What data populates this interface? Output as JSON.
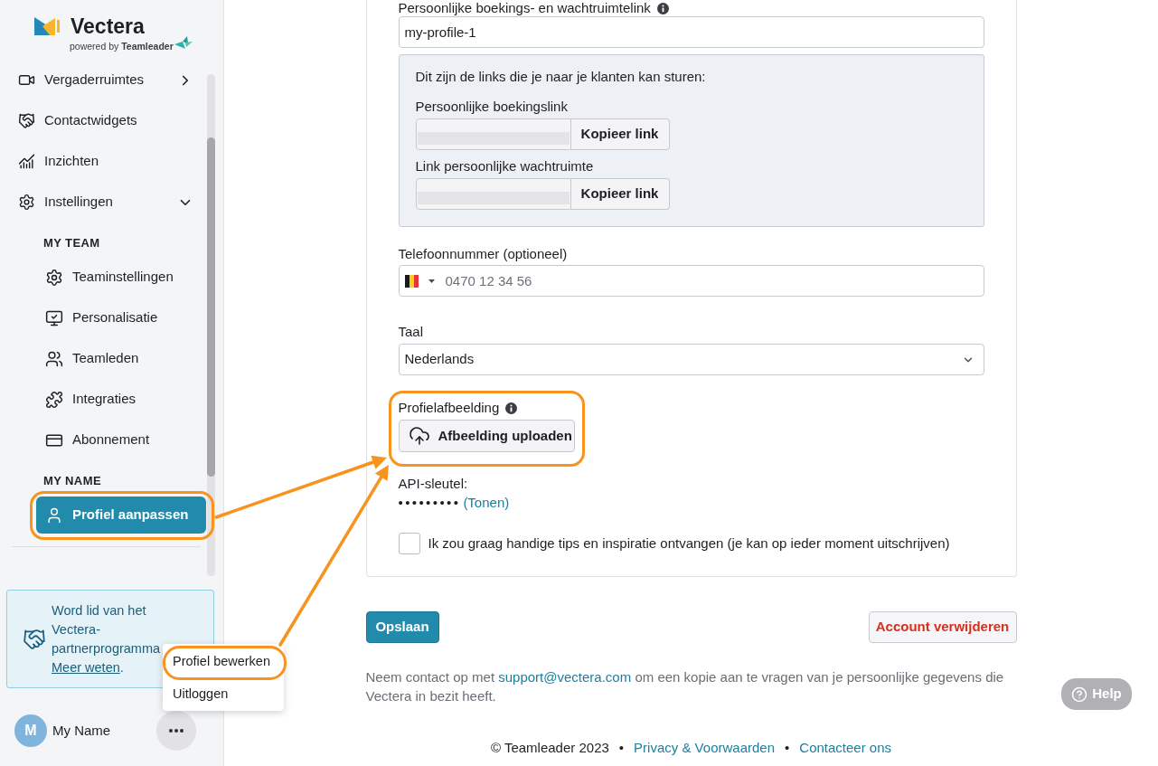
{
  "sidebar": {
    "logo": {
      "name": "Vectera",
      "tagline": "powered by **Teamleader**"
    },
    "nav": [
      {
        "label": "Vergaderruimtes",
        "selected": false,
        "expanded": false
      },
      {
        "label": "Contactwidgets",
        "selected": false
      },
      {
        "label": "Inzichten",
        "selected": false
      },
      {
        "label": "Instellingen",
        "selected": false,
        "expanded": true,
        "children": [
          {
            "heading": "MY TEAM",
            "items": [
              {
                "label": "Teaminstellingen",
                "selected": false
              },
              {
                "label": "Personalisatie",
                "selected": false
              },
              {
                "label": "Teamleden",
                "selected": false
              },
              {
                "label": "Integraties",
                "selected": false
              },
              {
                "label": "Abonnement",
                "selected": false
              }
            ]
          },
          {
            "heading": "MY NAME",
            "items": [
              {
                "label": "Profiel aanpassen",
                "selected": true
              }
            ]
          }
        ]
      }
    ],
    "partner_promo": {
      "text": "Word lid van het Vectera-partnerprogramma",
      "link": "Meer weten",
      "suffix": "."
    },
    "user": {
      "initial": "M",
      "name": "My Name"
    },
    "user_menu": {
      "items": [
        {
          "label": "Profiel bewerken"
        },
        {
          "label": "Uitloggen"
        }
      ]
    }
  },
  "form": {
    "booking_link": {
      "label": "Persoonlijke boekings- en wachtruimtelink",
      "value": "my-profile-1"
    },
    "links_box": {
      "intro": "Dit zijn de links die je naar je klanten kan sturen:",
      "links": [
        {
          "label": "Persoonlijke boekingslink",
          "button": "Kopieer link"
        },
        {
          "label": "Link persoonlijke wachtruimte",
          "button": "Kopieer link"
        }
      ]
    },
    "phone": {
      "label": "Telefoonnummer (optioneel)",
      "placeholder": "0470 12 34 56"
    },
    "language": {
      "label": "Taal",
      "value": "Nederlands"
    },
    "profile_image": {
      "label": "Profielafbeelding",
      "button": "Afbeelding uploaden"
    },
    "api_key": {
      "label": "API-sleutel:",
      "masked": "•••••••••",
      "link": "(Tonen)"
    },
    "newsletter": {
      "label": "Ik zou graag handige tips en inspiratie ontvangen (je kan op ieder moment uitschrijven)",
      "checked": false
    }
  },
  "actions": {
    "save": "Opslaan",
    "delete": "Account verwijderen"
  },
  "privacy_note": {
    "before": "Neem contact op met",
    "link": "support@vectera.com",
    "after": "om een kopie aan te vragen van je persoonlijke gegevens die Vectera in bezit heeft."
  },
  "footer": [
    {
      "kind": "text",
      "text": "© Teamleader 2023"
    },
    {
      "kind": "separator",
      "text": "•"
    },
    {
      "kind": "link",
      "text": "Privacy & Voorwaarden"
    },
    {
      "kind": "separator",
      "text": "•"
    },
    {
      "kind": "link",
      "text": "Contacteer ons"
    }
  ],
  "help_button": {
    "label": "Help"
  }
}
